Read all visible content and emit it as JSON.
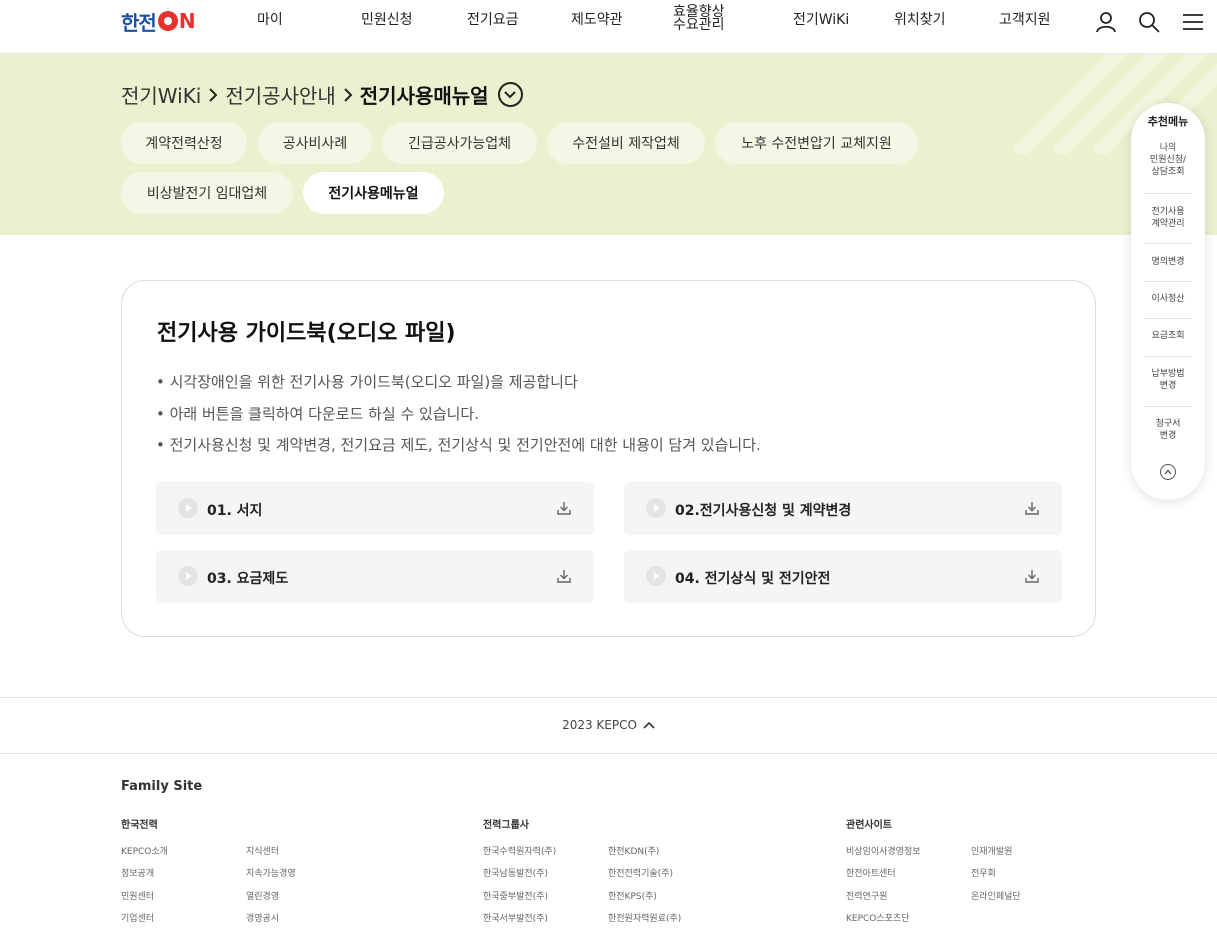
{
  "header": {
    "logo_text": "한전",
    "logo_suffix": "N",
    "nav": [
      "마이",
      "민원신청",
      "전기요금",
      "제도약관",
      "효율향상\n수요관리",
      "전기WiKi",
      "위치찾기",
      "고객지원"
    ],
    "icons": [
      "user-icon",
      "search-icon",
      "menu-icon"
    ]
  },
  "banner": {
    "breadcrumb": [
      "전기WiKi",
      "전기공사안내",
      "전기사용매뉴얼"
    ],
    "chips": [
      "계약전력산정",
      "공사비사례",
      "긴급공사가능업체",
      "수전설비 제작업체",
      "노후 수전변압기 교체지원",
      "비상발전기 임대업체",
      "전기사용메뉴얼"
    ],
    "active_chip": "전기사용메뉴얼"
  },
  "recommend_menu": {
    "title": "추천메뉴",
    "items": [
      "나의\n민원신청/\n상담조회",
      "전기사용\n계약관리",
      "명의변경",
      "이사정산",
      "요금조회",
      "납부방법\n변경",
      "청구서\n변경"
    ]
  },
  "card": {
    "title": "전기사용 가이드북(오디오 파일)",
    "bullets": [
      "• 시각장애인을 위한 전기사용 가이드북(오디오 파일)을 제공합니다",
      "• 아래 버튼을 클릭하여 다운로드 하실 수 있습니다.",
      "• 전기사용신청 및 계약변경, 전기요금 제도, 전기상식 및 전기안전에 대한 내용이 담겨 있습니다."
    ],
    "downloads": [
      "01. 서지",
      "02.전기사용신청 및 계약변경",
      "03. 요금제도",
      "04. 전기상식 및 전기안전"
    ]
  },
  "footer": {
    "copyright": "2023 KEPCO",
    "family_title": "Family Site",
    "groups": [
      {
        "title": "한국전력",
        "links": [
          [
            "KEPCO소개",
            "지식센터"
          ],
          [
            "정보공개",
            "지속가능경영"
          ],
          [
            "민원센터",
            "열린경영"
          ],
          [
            "기업센터",
            "경영공시"
          ]
        ]
      },
      {
        "title": "전력그룹사",
        "links": [
          [
            "한국수력원자력(주)",
            "한전KDN(주)"
          ],
          [
            "한국남동발전(주)",
            "한전전력기술(주)"
          ],
          [
            "한국중부발전(주)",
            "한전KPS(주)"
          ],
          [
            "한국서부발전(주)",
            "한전원자력원료(주)"
          ]
        ]
      },
      {
        "title": "관련사이트",
        "links": [
          [
            "비상임이사경영정보",
            "인재개발원"
          ],
          [
            "한전아트센터",
            "전우회"
          ],
          [
            "전력연구원",
            "온라인페널단"
          ],
          [
            "KEPCO스포츠단",
            ""
          ]
        ]
      }
    ]
  }
}
